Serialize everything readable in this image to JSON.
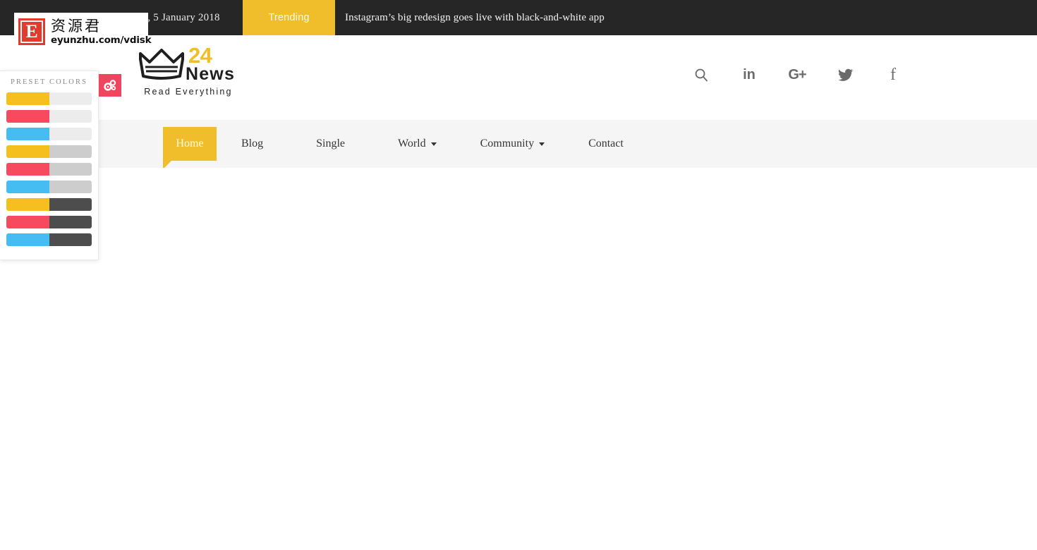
{
  "topbar": {
    "date": "Friday, 5 January 2018",
    "trending_label": "Trending",
    "headline": "Instagram’s big redesign goes live with black-and-white app"
  },
  "logo": {
    "icon": "crown-icon",
    "number": "24",
    "word": "News",
    "tagline": "Read Everything"
  },
  "social": {
    "items": [
      {
        "name": "search-icon",
        "label": "Search"
      },
      {
        "name": "linkedin-icon",
        "label": "in"
      },
      {
        "name": "google-plus-icon",
        "label": "G+"
      },
      {
        "name": "twitter-icon",
        "label": "Twitter"
      },
      {
        "name": "facebook-icon",
        "label": "f"
      }
    ]
  },
  "nav": {
    "items": [
      {
        "label": "Home",
        "active": true,
        "dropdown": false
      },
      {
        "label": "Blog",
        "active": false,
        "dropdown": false
      },
      {
        "label": "Single",
        "active": false,
        "dropdown": false
      },
      {
        "label": "World",
        "active": false,
        "dropdown": true
      },
      {
        "label": "Community",
        "active": false,
        "dropdown": true
      },
      {
        "label": "Contact",
        "active": false,
        "dropdown": false
      }
    ]
  },
  "style_panel": {
    "title": "PRESET COLORS",
    "toggle_icon": "gears-icon",
    "toggle_color": "#f0455f",
    "swatches": [
      {
        "left": "#f5c01e",
        "right": "#ececec"
      },
      {
        "left": "#f74a5f",
        "right": "#ececec"
      },
      {
        "left": "#45bdf3",
        "right": "#ececec"
      },
      {
        "left": "#f5c01e",
        "right": "#cdcdcd"
      },
      {
        "left": "#f74a5f",
        "right": "#cdcdcd"
      },
      {
        "left": "#45bdf3",
        "right": "#cdcdcd"
      },
      {
        "left": "#f5c01e",
        "right": "#4d4d4d"
      },
      {
        "left": "#f74a5f",
        "right": "#4d4d4d"
      },
      {
        "left": "#45bdf3",
        "right": "#4d4d4d"
      }
    ]
  },
  "watermark": {
    "badge_letter": "E",
    "cn_text": "资源君",
    "url": "eyunzhu.com/vdisk"
  },
  "theme": {
    "accent_yellow": "#f0be2a",
    "topbar_dark": "#262626",
    "nav_bg": "#f5f5f5"
  }
}
